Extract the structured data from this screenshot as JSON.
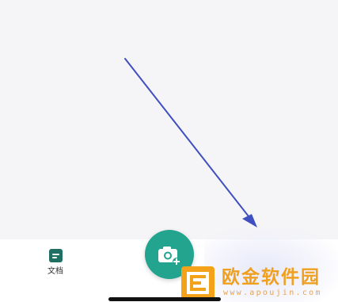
{
  "bottom_nav": {
    "items": [
      {
        "label": "文档",
        "icon": "document-icon"
      }
    ]
  },
  "fab": {
    "icon": "camera-plus-icon",
    "color": "#22a48e"
  },
  "annotation": {
    "type": "arrow",
    "color": "#3f4fc0"
  },
  "watermark": {
    "title": "欧金软件园",
    "url": "www.apoujin.com",
    "color": "#f0a020"
  }
}
